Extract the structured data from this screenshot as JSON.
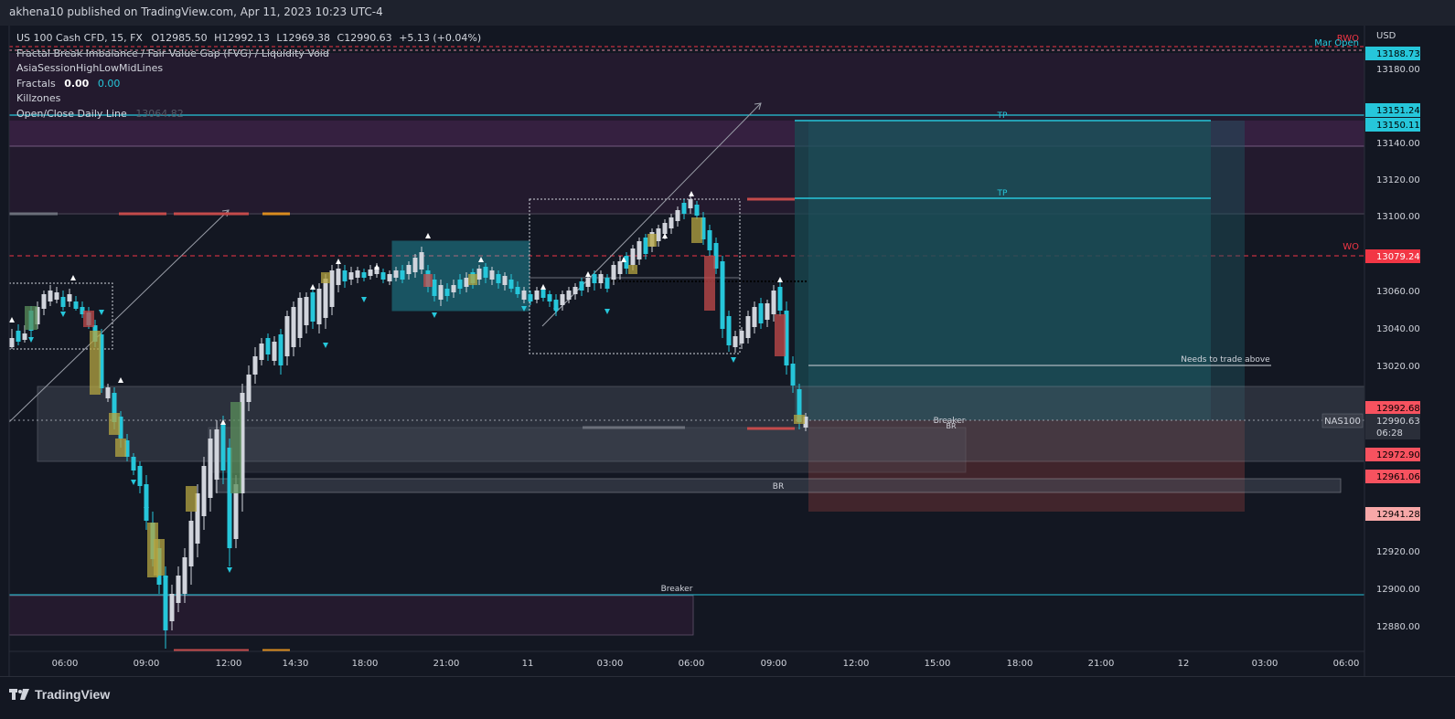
{
  "header": {
    "publish_line": "akhena10 published on TradingView.com, Apr 11, 2023 10:23 UTC-4"
  },
  "legend": {
    "symbol_line": "US 100 Cash CFD, 15, FX",
    "o": "O12985.50",
    "h": "H12992.13",
    "l": "L12969.38",
    "c": "C12990.63",
    "change": "+5.13 (+0.04%)",
    "indicator1": "Fractal Break Imbalance / Fair Value Gap (FVG) / Liquidity Void",
    "indicator2": "AsiaSessionHighLowMidLines",
    "indicator3_label": "Fractals",
    "indicator3_v1": "0.00",
    "indicator3_v2": "0.00",
    "indicator4": "Killzones",
    "indicator5": "Open/Close Daily Line",
    "indicator5_val": "13064.82"
  },
  "price_axis": {
    "currency": "USD",
    "ticks": [
      "13180.00",
      "13140.00",
      "13120.00",
      "13100.00",
      "13060.00",
      "13040.00",
      "13020.00",
      "12920.00",
      "12900.00",
      "12880.00"
    ],
    "badges": [
      {
        "text": "13188.73",
        "color": "#26c6da",
        "text_color": "#000000"
      },
      {
        "text": "13151.24",
        "color": "#26c6da",
        "text_color": "#000000"
      },
      {
        "text": "13150.11",
        "color": "#26c6da",
        "text_color": "#000000"
      },
      {
        "text": "13079.24",
        "color": "#f23645",
        "text_color": "#ffffff"
      },
      {
        "text": "12992.68",
        "color": "#f7525f",
        "text_color": "#000000"
      },
      {
        "text": "12990.63",
        "color": "#2a2e39",
        "text_color": "#d1d4dc"
      },
      {
        "text": "06:28",
        "color": "#2a2e39",
        "text_color": "#d1d4dc"
      },
      {
        "text": "12972.90",
        "color": "#f7525f",
        "text_color": "#000000"
      },
      {
        "text": "12961.06",
        "color": "#f7525f",
        "text_color": "#000000"
      },
      {
        "text": "12941.28",
        "color": "#f7a8a8",
        "text_color": "#000000"
      }
    ],
    "symbol_tag": "NAS100"
  },
  "time_axis": {
    "ticks": [
      "06:00",
      "09:00",
      "12:00",
      "14:30",
      "18:00",
      "21:00",
      "11",
      "03:00",
      "06:00",
      "09:00",
      "12:00",
      "15:00",
      "18:00",
      "21:00",
      "12",
      "03:00",
      "06:00"
    ]
  },
  "annotations": {
    "rwo": "RWO",
    "mar_open": "Mar Open",
    "wo": "WO",
    "tp1": "TP",
    "tp2": "TP",
    "needs_above": "Needs to trade above",
    "breaker1": "Breaker",
    "br1": "BR",
    "br2": "BR",
    "breaker2": "Breaker"
  },
  "footer": {
    "brand": "TradingView"
  },
  "colors": {
    "bg": "#131722",
    "up": "#d1d4dc",
    "down": "#26c6da",
    "fvg_yellow": "#b5a642",
    "fvg_green": "#5b8f5b",
    "fvg_red": "#c44b4b",
    "cyan": "#26c6da",
    "red": "#f23645"
  }
}
